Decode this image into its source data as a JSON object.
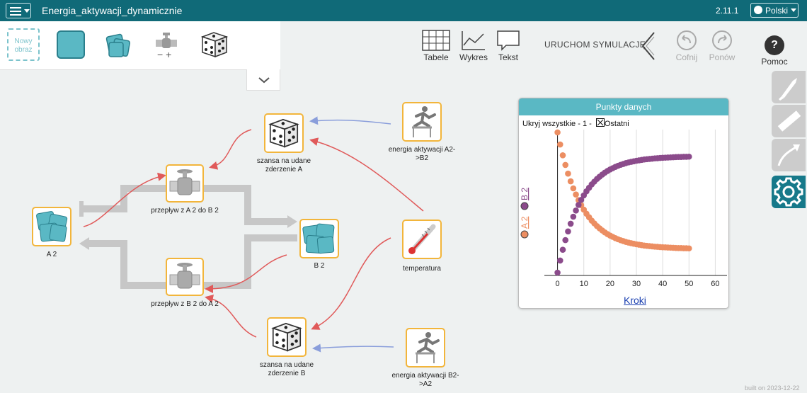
{
  "app": {
    "title": "Energia_aktywacji_dynamicznie",
    "version": "2.11.1",
    "language": "Polski",
    "built": "built on 2023-12-22"
  },
  "palette": {
    "new_image": "Nowy obraz"
  },
  "toolbar": {
    "tables": "Tabele",
    "graph": "Wykres",
    "text": "Tekst",
    "run": "URUCHOM SYMULACJĘ",
    "undo": "Cofnij",
    "redo": "Ponów",
    "help": "Pomoc"
  },
  "nodes": {
    "a2": "A 2",
    "b2": "B 2",
    "flow_ab": "przepływ z A 2 do B 2",
    "flow_ba": "przepływ z B 2 do A 2",
    "chance_a": "szansa na udane zderzenie A",
    "chance_b": "szansa na udane zderzenie B",
    "energy_ab": "energia aktywacji A2->B2",
    "energy_ba": "energia aktywacji B2->A2",
    "temperature": "temperatura"
  },
  "chart_data": {
    "type": "scatter",
    "title": "Punkty danych",
    "subtitle": "Ukryj wszystkie - 1 -",
    "last_label": "Ostatni",
    "xlabel": "Kroki",
    "ylabel_series": [
      "A 2",
      "B 2"
    ],
    "xlim": [
      -5,
      65
    ],
    "x_ticks": [
      0,
      10,
      20,
      30,
      40,
      50,
      60
    ],
    "grid": true,
    "series": [
      {
        "name": "A 2",
        "color": "#ec8e62",
        "x": [
          0,
          1,
          2,
          3,
          4,
          5,
          6,
          7,
          8,
          9,
          10,
          11,
          12,
          13,
          14,
          15,
          16,
          17,
          18,
          19,
          20,
          21,
          22,
          23,
          24,
          25,
          26,
          27,
          28,
          29,
          30,
          31,
          32,
          33,
          34,
          35,
          36,
          37,
          38,
          39,
          40,
          41,
          42,
          43,
          44,
          45,
          46,
          47,
          48,
          49,
          50
        ],
        "y": [
          100,
          91.4,
          83.7,
          76.8,
          70.6,
          65.1,
          60.1,
          55.7,
          51.7,
          48.1,
          44.9,
          42.0,
          39.5,
          37.1,
          35.1,
          33.2,
          31.6,
          30.1,
          28.7,
          27.5,
          26.4,
          25.5,
          24.6,
          23.8,
          23.1,
          22.5,
          21.9,
          21.4,
          21.0,
          20.6,
          20.2,
          19.9,
          19.6,
          19.3,
          19.1,
          18.9,
          18.7,
          18.5,
          18.4,
          18.2,
          18.1,
          18.0,
          17.9,
          17.8,
          17.7,
          17.6,
          17.5,
          17.5,
          17.4,
          17.4,
          17.3
        ]
      },
      {
        "name": "B 2",
        "color": "#8b4b8b",
        "x": [
          0,
          1,
          2,
          3,
          4,
          5,
          6,
          7,
          8,
          9,
          10,
          11,
          12,
          13,
          14,
          15,
          16,
          17,
          18,
          19,
          20,
          21,
          22,
          23,
          24,
          25,
          26,
          27,
          28,
          29,
          30,
          31,
          32,
          33,
          34,
          35,
          36,
          37,
          38,
          39,
          40,
          41,
          42,
          43,
          44,
          45,
          46,
          47,
          48,
          49,
          50
        ],
        "y": [
          0,
          8.6,
          16.3,
          23.2,
          29.4,
          34.9,
          39.9,
          44.3,
          48.3,
          51.9,
          55.1,
          58.0,
          60.5,
          62.9,
          64.9,
          66.8,
          68.4,
          69.9,
          71.3,
          72.5,
          73.6,
          74.5,
          75.4,
          76.2,
          76.9,
          77.5,
          78.1,
          78.6,
          79.0,
          79.4,
          79.8,
          80.1,
          80.4,
          80.7,
          80.9,
          81.1,
          81.3,
          81.5,
          81.6,
          81.8,
          81.9,
          82.0,
          82.1,
          82.2,
          82.3,
          82.4,
          82.5,
          82.5,
          82.6,
          82.6,
          82.7
        ]
      }
    ]
  },
  "colors": {
    "topbar": "#106a78",
    "node_border": "#f2b53b",
    "link_red": "#e05a5a",
    "link_blue": "#8a9edb",
    "flow_gray": "#c7c7c7"
  }
}
